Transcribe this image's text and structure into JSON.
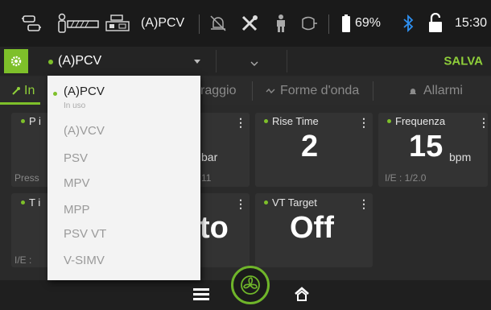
{
  "status_bar": {
    "mode_text": "(A)PCV",
    "battery_percent": "69%",
    "time": "15:30",
    "icons": [
      "lung-connection-icon",
      "patient-icon",
      "tube-icon",
      "ventilator-icon",
      "alarm-off-icon",
      "tools-icon",
      "person-icon",
      "bag-icon",
      "battery-icon",
      "bluetooth-icon",
      "unlocked-icon"
    ]
  },
  "mode_bar": {
    "selected_mode": "(A)PCV",
    "save_label": "SALVA"
  },
  "tabs": [
    {
      "label": "In",
      "icon": "wrench-icon",
      "active": true
    },
    {
      "label": "raggio"
    },
    {
      "label": "Forme d'onda",
      "icon": "wave-icon"
    },
    {
      "label": "Allarmi",
      "icon": "bell-icon"
    }
  ],
  "cards": {
    "p_insp": {
      "title": "P i",
      "foot": "Press",
      "unit": "bar",
      "foot2": "11"
    },
    "rise_time": {
      "title": "Rise Time",
      "value": "2"
    },
    "frequency": {
      "title": "Frequenza",
      "value": "15",
      "unit": "bpm",
      "foot": "I/E : 1/2.0"
    },
    "t_insp": {
      "title": "T i",
      "foot": "I/E :",
      "value": "to"
    },
    "vt_target": {
      "title": "VT Target",
      "value": "Off"
    }
  },
  "dropdown": {
    "items": [
      {
        "label": "(A)PCV",
        "sub": "In uso",
        "selected": true
      },
      {
        "label": "(A)VCV"
      },
      {
        "label": "PSV"
      },
      {
        "label": "MPV"
      },
      {
        "label": "MPP"
      },
      {
        "label": "PSV VT"
      },
      {
        "label": "V-SIMV"
      }
    ]
  },
  "colors": {
    "accent": "#7ec02a",
    "background": "#2a2a2a",
    "card": "#333333",
    "bluetooth": "#2e8ff0"
  }
}
